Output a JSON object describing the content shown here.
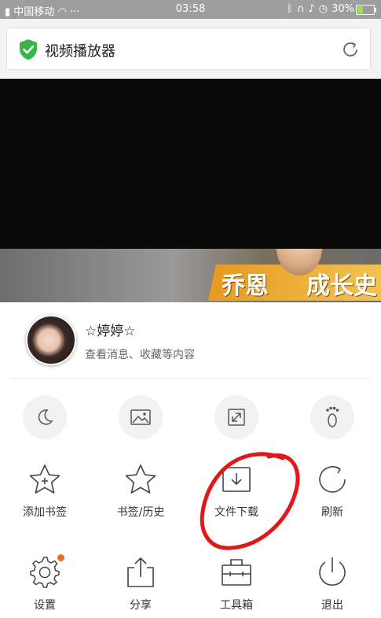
{
  "status_bar": {
    "carrier": "中国移动",
    "time": "03:58",
    "battery": "30%",
    "battery_level": 0.3
  },
  "address_bar": {
    "title": "视频播放器",
    "security_icon": "shield-check-icon",
    "reload_icon": "reload-icon"
  },
  "banner": {
    "text_left": "乔恩",
    "text_right": "成长史"
  },
  "profile": {
    "name": "☆婷婷☆",
    "subtitle": "查看消息、收藏等内容"
  },
  "quick_toggles": [
    {
      "name": "night-mode",
      "icon": "moon-icon"
    },
    {
      "name": "no-image",
      "icon": "image-icon"
    },
    {
      "name": "fullscreen",
      "icon": "expand-icon"
    },
    {
      "name": "no-trace",
      "icon": "footprint-icon"
    }
  ],
  "menu_row1": [
    {
      "label": "添加书签",
      "icon": "star-plus-icon"
    },
    {
      "label": "书签/历史",
      "icon": "star-icon"
    },
    {
      "label": "文件下载",
      "icon": "download-icon"
    },
    {
      "label": "刷新",
      "icon": "refresh-icon"
    }
  ],
  "menu_row2": [
    {
      "label": "设置",
      "icon": "gear-icon"
    },
    {
      "label": "分享",
      "icon": "share-icon"
    },
    {
      "label": "工具箱",
      "icon": "toolbox-icon"
    },
    {
      "label": "退出",
      "icon": "power-icon"
    }
  ],
  "colors": {
    "accent_green": "#3bb54a",
    "notification_dot": "#f06c2a",
    "annotation_red": "#e01818"
  }
}
